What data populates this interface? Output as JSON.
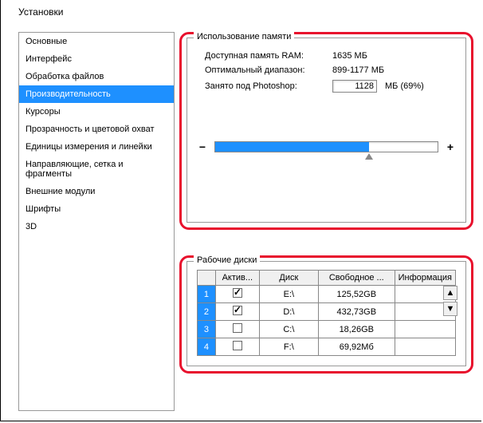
{
  "window_title": "Установки",
  "sidebar": {
    "items": [
      {
        "label": "Основные"
      },
      {
        "label": "Интерфейс"
      },
      {
        "label": "Обработка файлов"
      },
      {
        "label": "Производительность",
        "selected": true
      },
      {
        "label": "Курсоры"
      },
      {
        "label": "Прозрачность и цветовой охват"
      },
      {
        "label": "Единицы измерения и линейки"
      },
      {
        "label": "Направляющие, сетка и фрагменты"
      },
      {
        "label": "Внешние модули"
      },
      {
        "label": "Шрифты"
      },
      {
        "label": "3D"
      }
    ]
  },
  "memory": {
    "legend": "Использование памяти",
    "available_label": "Доступная память RAM:",
    "available_value": "1635 МБ",
    "range_label": "Оптимальный диапазон:",
    "range_value": "899-1177 МБ",
    "used_label": "Занято под Photoshop:",
    "used_input": "1128",
    "used_unit": "МБ (69%)",
    "minus": "−",
    "plus": "+",
    "slider_percent": 69
  },
  "scratch": {
    "legend": "Рабочие диски",
    "headers": {
      "num": "",
      "active": "Актив...",
      "disk": "Диск",
      "free": "Свободное ...",
      "info": "Информация"
    },
    "rows": [
      {
        "num": "1",
        "active": true,
        "disk": "E:\\",
        "free": "125,52GB",
        "info": ""
      },
      {
        "num": "2",
        "active": true,
        "disk": "D:\\",
        "free": "432,73GB",
        "info": ""
      },
      {
        "num": "3",
        "active": false,
        "disk": "C:\\",
        "free": "18,26GB",
        "info": ""
      },
      {
        "num": "4",
        "active": false,
        "disk": "F:\\",
        "free": "69,92Мб",
        "info": ""
      }
    ],
    "up": "▲",
    "down": "▼"
  }
}
